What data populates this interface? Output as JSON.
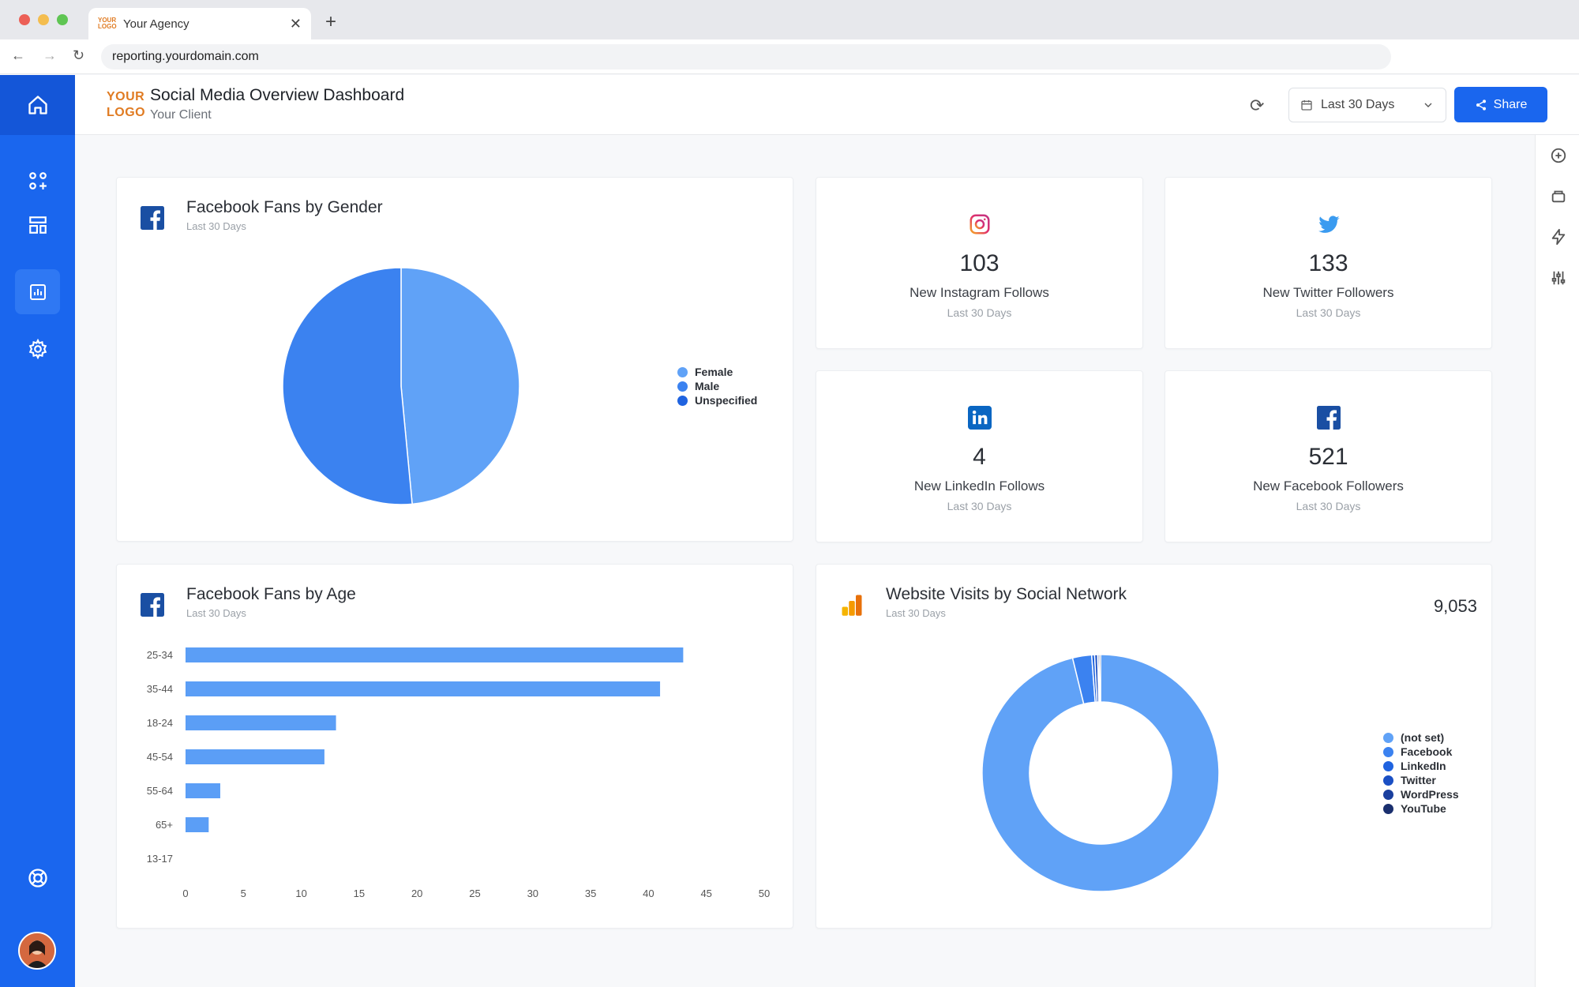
{
  "browser": {
    "tab_logo": "YOUR LOGO",
    "tab_title": "Your Agency",
    "url": "reporting.yourdomain.com"
  },
  "header": {
    "logo_line1": "YOUR",
    "logo_line2": "LOGO",
    "title": "Social Media Overview Dashboard",
    "subtitle": "Your Client",
    "date_range": "Last 30 Days",
    "share_label": "Share"
  },
  "colors": {
    "primary": "#1a66ee",
    "bar": "#5b9ef6",
    "slice_light": "#60a2f7",
    "slice_mid": "#3b82f0",
    "accent_orange": "#e07b22"
  },
  "cards": {
    "gender": {
      "title": "Facebook Fans by Gender",
      "subtitle": "Last 30 Days"
    },
    "age": {
      "title": "Facebook Fans by Age",
      "subtitle": "Last 30 Days"
    },
    "visits": {
      "title": "Website Visits by Social Network",
      "subtitle": "Last 30 Days",
      "total": "9,053"
    }
  },
  "stats": [
    {
      "icon": "instagram-icon",
      "value": "103",
      "label": "New Instagram Follows",
      "sub": "Last 30 Days"
    },
    {
      "icon": "twitter-icon",
      "value": "133",
      "label": "New Twitter Followers",
      "sub": "Last 30 Days"
    },
    {
      "icon": "linkedin-icon",
      "value": "4",
      "label": "New LinkedIn Follows",
      "sub": "Last 30 Days"
    },
    {
      "icon": "facebook-icon",
      "value": "521",
      "label": "New Facebook Followers",
      "sub": "Last 30 Days"
    }
  ],
  "chart_data": [
    {
      "type": "pie",
      "labels": [
        "Female",
        "Male",
        "Unspecified"
      ],
      "values": [
        48.5,
        51.5,
        0
      ],
      "colors": [
        "#60a2f7",
        "#3b82f0",
        "#1f63e0"
      ],
      "legend": "right"
    },
    {
      "type": "bar",
      "orientation": "horizontal",
      "categories": [
        "25-34",
        "35-44",
        "18-24",
        "45-54",
        "55-64",
        "65+",
        "13-17"
      ],
      "values": [
        43,
        41,
        13,
        12,
        3,
        2,
        0
      ],
      "xlim": [
        0,
        50
      ],
      "xticks": [
        0,
        5,
        10,
        15,
        20,
        25,
        30,
        35,
        40,
        45,
        50
      ]
    },
    {
      "type": "pie",
      "donut": true,
      "labels": [
        "(not set)",
        "Facebook",
        "LinkedIn",
        "Twitter",
        "WordPress",
        "YouTube"
      ],
      "values": [
        96.2,
        2.6,
        0.4,
        0.4,
        0.2,
        0.2
      ],
      "colors": [
        "#60a2f7",
        "#3b82f0",
        "#1f63e0",
        "#1a4fc4",
        "#1a3f9e",
        "#1a2f6e"
      ],
      "legend": "right"
    }
  ]
}
